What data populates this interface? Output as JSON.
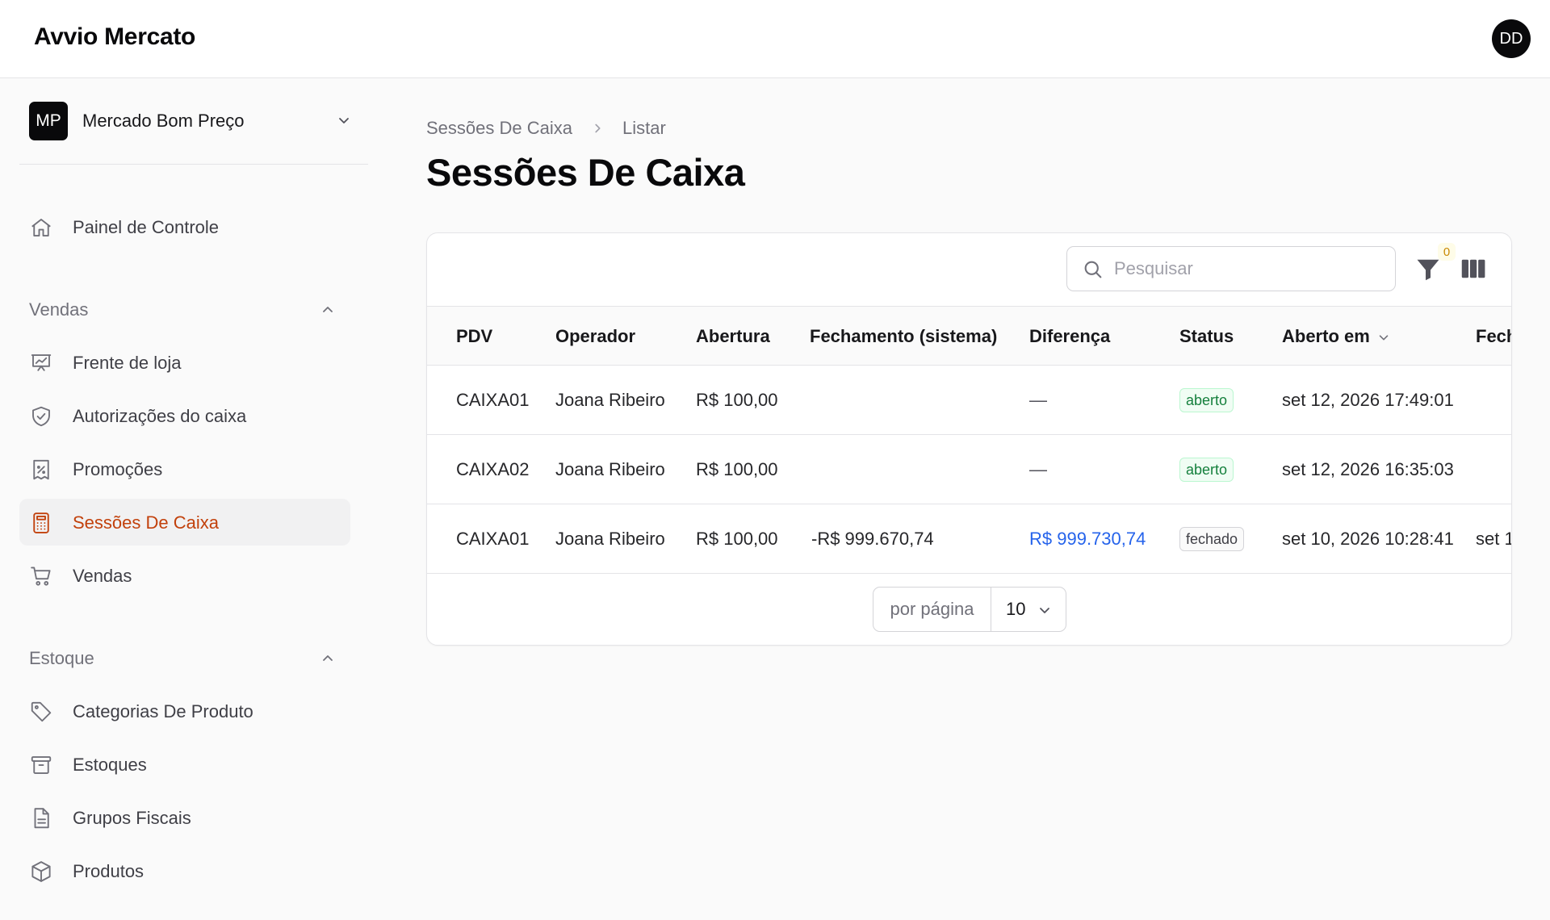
{
  "app": {
    "brand": "Avvio Mercato",
    "user_initials": "DD"
  },
  "tenant": {
    "initials": "MP",
    "name": "Mercado Bom Preço"
  },
  "nav": {
    "dashboard": "Painel de Controle",
    "groups": [
      {
        "label": "Vendas",
        "items": [
          {
            "label": "Frente de loja",
            "icon": "presentation-chart-icon"
          },
          {
            "label": "Autorizações do caixa",
            "icon": "shield-check-icon"
          },
          {
            "label": "Promoções",
            "icon": "receipt-percent-icon"
          },
          {
            "label": "Sessões De Caixa",
            "icon": "calculator-icon",
            "active": true
          },
          {
            "label": "Vendas",
            "icon": "shopping-cart-icon"
          }
        ]
      },
      {
        "label": "Estoque",
        "items": [
          {
            "label": "Categorias De Produto",
            "icon": "tag-icon"
          },
          {
            "label": "Estoques",
            "icon": "archive-box-icon"
          },
          {
            "label": "Grupos Fiscais",
            "icon": "document-text-icon"
          },
          {
            "label": "Produtos",
            "icon": "cube-icon"
          }
        ]
      }
    ]
  },
  "breadcrumb": {
    "parent": "Sessões De Caixa",
    "current": "Listar"
  },
  "page_title": "Sessões De Caixa",
  "toolbar": {
    "search_placeholder": "Pesquisar",
    "filter_count": "0"
  },
  "table": {
    "columns": [
      "PDV",
      "Operador",
      "Abertura",
      "Fechamento (sistema)",
      "Diferença",
      "Status",
      "Aberto em",
      "Fech"
    ],
    "rows": [
      {
        "pdv": "CAIXA01",
        "operador": "Joana Ribeiro",
        "abertura": "R$ 100,00",
        "fechamento": "",
        "diferenca": "—",
        "status": "aberto",
        "aberto_em": "set 12, 2026 17:49:01",
        "fech": ""
      },
      {
        "pdv": "CAIXA02",
        "operador": "Joana Ribeiro",
        "abertura": "R$ 100,00",
        "fechamento": "",
        "diferenca": "—",
        "status": "aberto",
        "aberto_em": "set 12, 2026 16:35:03",
        "fech": ""
      },
      {
        "pdv": "CAIXA01",
        "operador": "Joana Ribeiro",
        "abertura": "R$ 100,00",
        "fechamento": "-R$ 999.670,74",
        "diferenca": "R$ 999.730,74",
        "status": "fechado",
        "aberto_em": "set 10, 2026 10:28:41",
        "fech": "set 1"
      }
    ]
  },
  "pagination": {
    "per_page_label": "por página",
    "per_page_value": "10"
  },
  "colors": {
    "accent": "#c2410c",
    "link": "#2563eb",
    "success": "#15803d"
  }
}
